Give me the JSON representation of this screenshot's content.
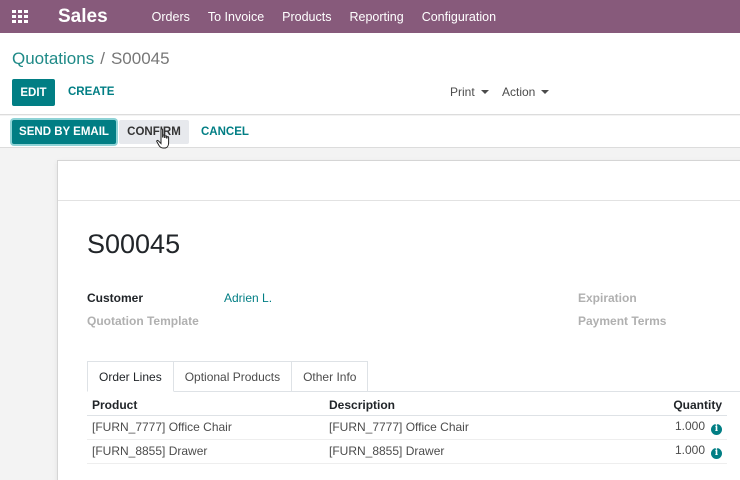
{
  "navbar": {
    "app_name": "Sales",
    "menu": [
      "Orders",
      "To Invoice",
      "Products",
      "Reporting",
      "Configuration"
    ]
  },
  "breadcrumb": {
    "parent": "Quotations",
    "separator": "/",
    "current": "S00045"
  },
  "toolbar": {
    "edit_label": "EDIT",
    "create_label": "CREATE",
    "print_label": "Print",
    "action_label": "Action"
  },
  "statusbar": {
    "send_label": "SEND BY EMAIL",
    "confirm_label": "CONFIRM",
    "cancel_label": "CANCEL"
  },
  "form": {
    "name": "S00045",
    "customer_label": "Customer",
    "customer_value": "Adrien L.",
    "template_label": "Quotation Template",
    "expiration_label": "Expiration",
    "payment_terms_label": "Payment Terms"
  },
  "tabs": [
    "Order Lines",
    "Optional Products",
    "Other Info"
  ],
  "lines": {
    "headers": {
      "product": "Product",
      "description": "Description",
      "quantity": "Quantity"
    },
    "rows": [
      {
        "product": "[FURN_7777] Office Chair",
        "description": "[FURN_7777] Office Chair",
        "quantity": "1.000"
      },
      {
        "product": "[FURN_8855] Drawer",
        "description": "[FURN_8855] Drawer",
        "quantity": "1.000"
      }
    ]
  },
  "colors": {
    "brand": "#875a7b",
    "accent": "#017e84"
  },
  "icons": {
    "apps": "apps-grid-icon",
    "info": "info-icon",
    "cursor": "hand-pointer-icon"
  }
}
